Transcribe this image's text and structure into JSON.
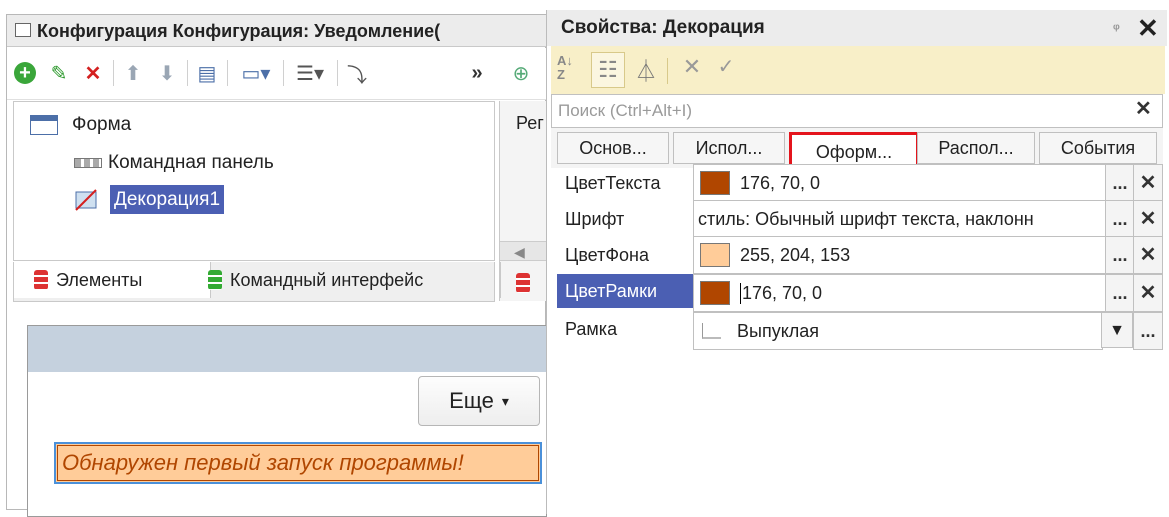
{
  "left_window": {
    "title": "Конфигурация Конфигурация: Уведомление(",
    "tree": {
      "root": "Форма",
      "items": [
        "Командная панель",
        "Декорация1"
      ]
    },
    "side_label": "Рег",
    "tabs": [
      "Элементы",
      "Командный интерфейс"
    ],
    "preview": {
      "more_label": "Еще",
      "decoration_text": "Обнаружен первый запуск программы!"
    }
  },
  "properties": {
    "title": "Свойства: Декорация",
    "search_placeholder": "Поиск (Ctrl+Alt+I)",
    "tabs": [
      "Основ...",
      "Испол...",
      "Оформ...",
      "Распол...",
      "События"
    ],
    "active_tab": "Оформ...",
    "rows": [
      {
        "label": "ЦветТекста",
        "value": "176, 70, 0",
        "swatch": "#b04600"
      },
      {
        "label": "Шрифт",
        "value": "стиль: Обычный шрифт текста, наклонн"
      },
      {
        "label": "ЦветФона",
        "value": "255, 204, 153",
        "swatch": "#ffcc99"
      },
      {
        "label": "ЦветРамки",
        "value": "176, 70, 0",
        "swatch": "#b04600"
      },
      {
        "label": "Рамка",
        "value": "Выпуклая"
      }
    ]
  },
  "colors": {
    "accent_selection": "#4b5fb3",
    "highlight_red": "#e4141c",
    "text_color": "#b04600",
    "bg_color": "#ffcc99"
  }
}
